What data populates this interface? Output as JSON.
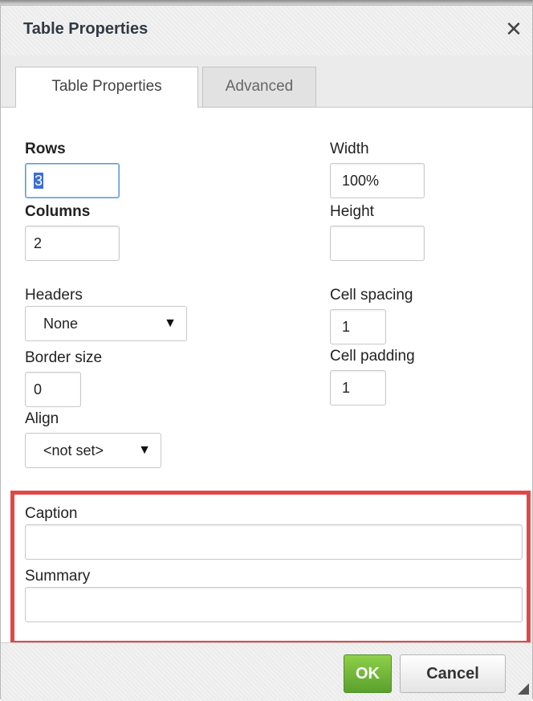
{
  "dialog": {
    "title": "Table Properties",
    "close_glyph": "✕"
  },
  "tabs": [
    {
      "label": "Table Properties",
      "active": true
    },
    {
      "label": "Advanced",
      "active": false
    }
  ],
  "fields": {
    "rows": {
      "label": "Rows",
      "value": "3"
    },
    "columns": {
      "label": "Columns",
      "value": "2"
    },
    "width": {
      "label": "Width",
      "value": "100%"
    },
    "height": {
      "label": "Height",
      "value": ""
    },
    "headers": {
      "label": "Headers",
      "value": "None"
    },
    "cell_spacing": {
      "label": "Cell spacing",
      "value": "1"
    },
    "border_size": {
      "label": "Border size",
      "value": "0"
    },
    "cell_padding": {
      "label": "Cell padding",
      "value": "1"
    },
    "align": {
      "label": "Align",
      "value": "<not set>"
    },
    "caption": {
      "label": "Caption",
      "value": ""
    },
    "summary": {
      "label": "Summary",
      "value": ""
    }
  },
  "footer": {
    "ok_label": "OK",
    "cancel_label": "Cancel"
  },
  "colors": {
    "highlight_border": "#e04848",
    "ok_button": "#6db636"
  },
  "icons": {
    "close": "close-icon",
    "dropdown": "chevron-down-icon",
    "resize": "resize-grip-icon"
  }
}
